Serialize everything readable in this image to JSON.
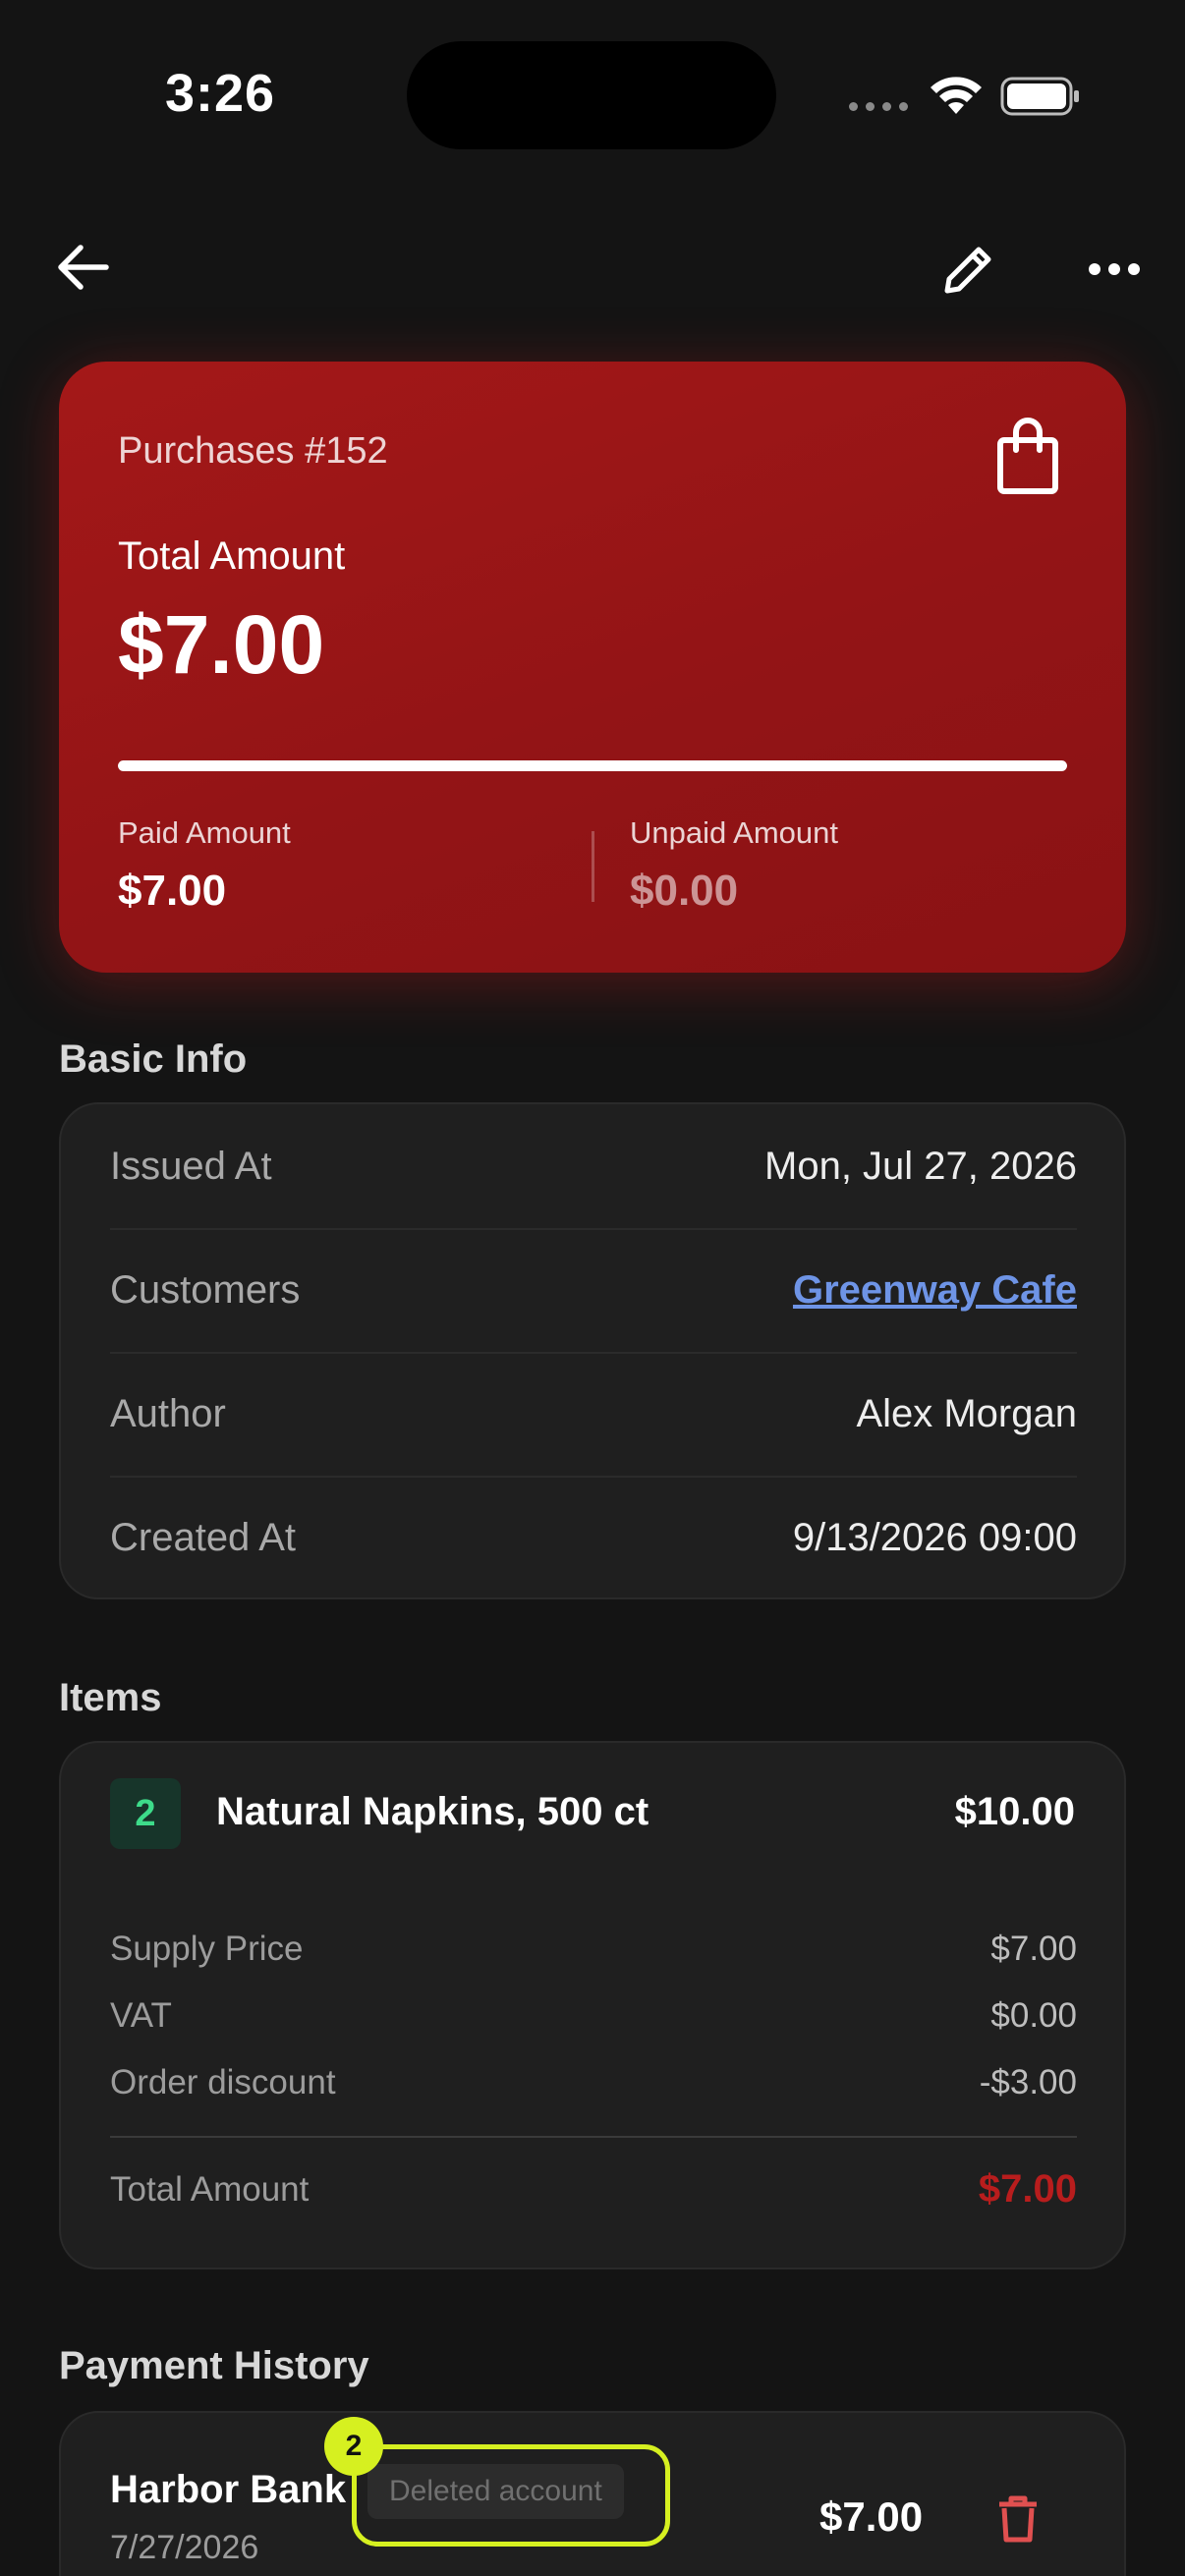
{
  "status_bar": {
    "time": "3:26"
  },
  "nav": {
    "back_icon": "arrow-left-icon",
    "edit_icon": "pencil-icon",
    "more_icon": "more-horizontal-icon"
  },
  "hero": {
    "title": "Purchases #152",
    "icon": "shopping-bag-icon",
    "total_label": "Total Amount",
    "total_value": "$7.00",
    "paid_fraction": 1.0,
    "paid_label": "Paid Amount",
    "paid_value": "$7.00",
    "unpaid_label": "Unpaid Amount",
    "unpaid_value": "$0.00",
    "color": "#9b1616"
  },
  "basic_info": {
    "heading": "Basic Info",
    "rows": [
      {
        "label": "Issued At",
        "value": "Mon, Jul 27, 2026"
      },
      {
        "label": "Customers",
        "value": "Greenway Cafe"
      },
      {
        "label": "Author",
        "value": "Alex Morgan"
      },
      {
        "label": "Created At",
        "value": "9/13/2026 09:00"
      }
    ]
  },
  "items": {
    "heading": "Items",
    "entries": [
      {
        "quantity": "2",
        "name": "Natural Napkins, 500 ct",
        "price": "$10.00",
        "details": [
          {
            "label": "Supply Price",
            "value": "$7.00"
          },
          {
            "label": "VAT",
            "value": "$0.00"
          },
          {
            "label": "Order discount",
            "value": "-$3.00"
          }
        ],
        "total_label": "Total Amount",
        "total_value": "$7.00"
      }
    ]
  },
  "payment_history": {
    "heading": "Payment History",
    "entries": [
      {
        "bank": "Harbor Bank",
        "date": "7/27/2026",
        "badge": "Deleted account",
        "amount": "$7.00",
        "delete_icon": "trash-icon"
      }
    ]
  },
  "annotation": {
    "marker": "2",
    "color": "#d6f020"
  },
  "colors": {
    "background": "#141414",
    "card": "#1f1f1f",
    "link": "#6e94e6",
    "danger": "#e05050",
    "total_red": "#b81d1d"
  }
}
